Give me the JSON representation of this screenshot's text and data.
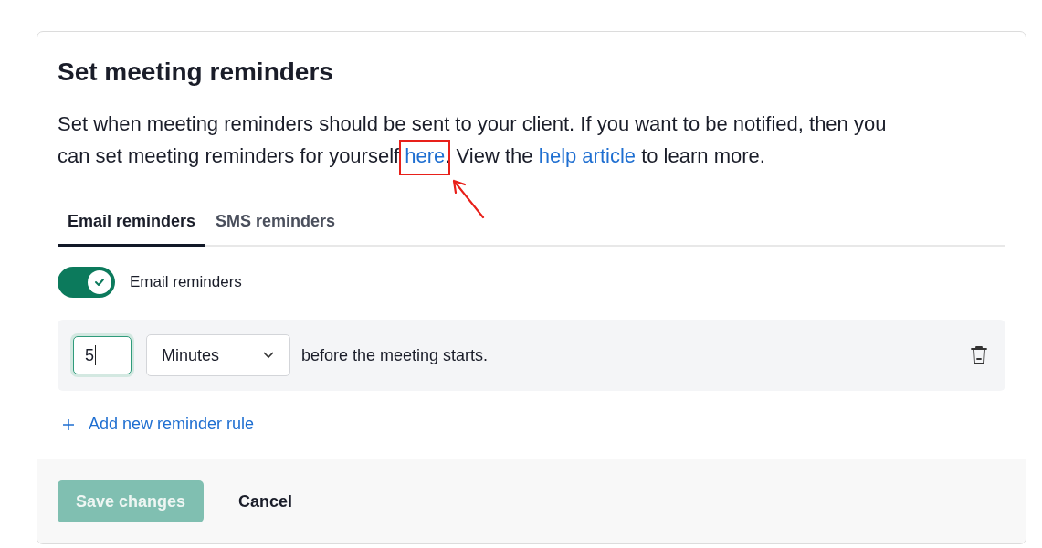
{
  "title": "Set meeting reminders",
  "description": [
    {
      "kind": "text",
      "text": "Set when meeting reminders should be sent to your client. If you want to be notified, then you can set meeting reminders for yourself "
    },
    {
      "kind": "link",
      "text": "here",
      "highlighted": true
    },
    {
      "kind": "text",
      "text": ". View the "
    },
    {
      "kind": "link",
      "text": "help article",
      "highlighted": false
    },
    {
      "kind": "text",
      "text": " to learn more."
    }
  ],
  "tabs": [
    {
      "label": "Email reminders",
      "selected": true
    },
    {
      "label": "SMS reminders",
      "selected": false
    }
  ],
  "toggle": {
    "label": "Email reminders",
    "on": true
  },
  "rules": [
    {
      "value": "5",
      "unit": "Minutes",
      "suffix": "before the meeting starts."
    }
  ],
  "add_rule": "Add new reminder rule",
  "buttons": [
    {
      "label": "Save changes",
      "kind": "primary",
      "disabled": true
    },
    {
      "label": "Cancel",
      "kind": "plain",
      "disabled": false
    }
  ]
}
